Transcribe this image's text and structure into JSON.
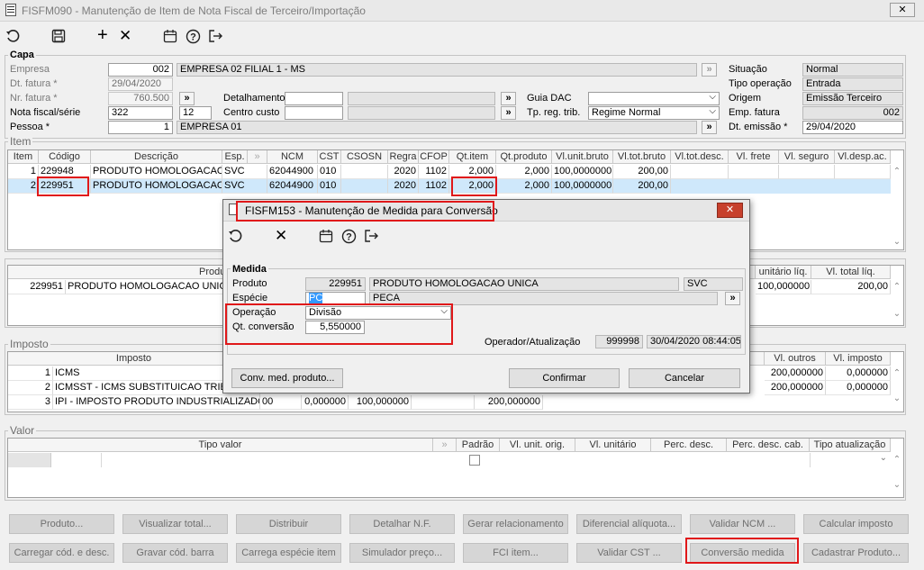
{
  "window": {
    "title": "FISFM090 - Manutenção de Item de Nota Fiscal de Terceiro/Importação",
    "close": "✕"
  },
  "toolbar": {
    "undo": "undo-icon",
    "save": "save-icon",
    "add": "+",
    "cancel": "✕",
    "calendar": "calendar-icon",
    "help": "?",
    "exit": "exit-icon"
  },
  "capa": {
    "title": "Capa",
    "empresa_label": "Empresa",
    "empresa_code": "002",
    "empresa_name": "EMPRESA 02 FILIAL 1 - MS",
    "dt_fatura_label": "Dt. fatura *",
    "dt_fatura": "29/04/2020",
    "nr_fatura_label": "Nr. fatura *",
    "nr_fatura": "760.500",
    "nf_serie_label": "Nota fiscal/série",
    "nf": "322",
    "serie": "12",
    "pessoa_label": "Pessoa *",
    "pessoa_code": "1",
    "pessoa_name": "EMPRESA 01",
    "detalhamento_label": "Detalhamento",
    "centro_custo_label": "Centro custo",
    "guia_dac_label": "Guia DAC",
    "tp_reg_trib_label": "Tp. reg. trib.",
    "tp_reg_trib": "Regime Normal",
    "situacao_label": "Situação",
    "situacao": "Normal",
    "tipo_operacao_label": "Tipo operação",
    "tipo_operacao": "Entrada",
    "origem_label": "Origem",
    "origem": "Emissão Terceiro",
    "emp_fatura_label": "Emp. fatura",
    "emp_fatura": "002",
    "dt_emissao_label": "Dt. emissão *",
    "dt_emissao": "29/04/2020",
    "lookup": "»"
  },
  "item": {
    "title": "Item",
    "columns": [
      "Item",
      "Código",
      "Descrição",
      "Esp.",
      "NCM",
      "CST",
      "CSOSN",
      "Regra",
      "CFOP",
      "Qt.item",
      "Qt.produto",
      "Vl.unit.bruto",
      "Vl.tot.bruto",
      "Vl.tot.desc.",
      "Vl. frete",
      "Vl. seguro",
      "Vl.desp.ac."
    ],
    "rows": [
      [
        "1",
        "229948",
        "PRODUTO HOMOLOGACAO",
        "SVC",
        "62044900",
        "010",
        "",
        "2020",
        "1102",
        "2,000",
        "2,000",
        "100,0000000",
        "200,00",
        "",
        "",
        "",
        ""
      ],
      [
        "2",
        "229951",
        "PRODUTO HOMOLOGACAO U",
        "SVC",
        "62044900",
        "010",
        "",
        "2020",
        "1102",
        "2,000",
        "2,000",
        "100,0000000",
        "200,00",
        "",
        "",
        "",
        ""
      ]
    ]
  },
  "produto_grid": {
    "col_produto": "Produ",
    "col_unit": "unitário líq.",
    "col_total": "Vl. total líq.",
    "code": "229951",
    "desc": "PRODUTO HOMOLOGACAO UNICA",
    "unit": "100,000000",
    "total": "200,00"
  },
  "imposto": {
    "title": "Imposto",
    "col_imposto": "Imposto",
    "col_outros": "Vl. outros",
    "col_vimposto": "Vl. imposto",
    "rows": [
      {
        "n": "1",
        "name": "ICMS",
        "outros": "200,000000",
        "vimposto": "0,000000"
      },
      {
        "n": "2",
        "name": "ICMSST - ICMS SUBSTITUICAO TRIBUT",
        "outros": "200,000000",
        "vimposto": "0,000000"
      },
      {
        "n": "3",
        "name": "IPI - IMPOSTO PRODUTO INDUSTRIALIZADO",
        "c1": "00",
        "c2": "0,000000",
        "c3": "100,000000",
        "c4": "200,000000"
      }
    ]
  },
  "valor": {
    "title": "Valor",
    "columns": [
      "Tipo valor",
      "Padrão",
      "Vl. unit. orig.",
      "Vl. unitário",
      "Perc. desc.",
      "Perc. desc. cab.",
      "Tipo atualização"
    ]
  },
  "buttons": {
    "row1": [
      "Produto...",
      "Visualizar total...",
      "Distribuir",
      "Detalhar N.F.",
      "Gerar relacionamento",
      "Diferencial alíquota...",
      "Validar NCM ...",
      "Calcular imposto"
    ],
    "row2": [
      "Carregar cód. e desc.",
      "Gravar cód. barra",
      "Carrega espécie item",
      "Simulador preço...",
      "FCI item...",
      "Validar CST ...",
      "Conversão medida",
      "Cadastrar Produto..."
    ]
  },
  "dialog": {
    "title": "FISFM153 - Manutenção de Medida para Conversão",
    "close": "✕",
    "medida_title": "Medida",
    "produto_label": "Produto",
    "produto_code": "229951",
    "produto_desc": "PRODUTO HOMOLOGACAO UNICA",
    "produto_esp": "SVC",
    "especie_label": "Espécie",
    "especie_code": "PC",
    "especie_desc": "PECA",
    "operacao_label": "Operação",
    "operacao": "Divisão",
    "qt_conv_label": "Qt. conversão",
    "qt_conv": "5,550000",
    "operador_label": "Operador/Atualização",
    "operador": "999998",
    "atualizacao": "30/04/2020 08:44:05",
    "btn_conv": "Conv. med. produto...",
    "btn_confirmar": "Confirmar",
    "btn_cancelar": "Cancelar"
  }
}
